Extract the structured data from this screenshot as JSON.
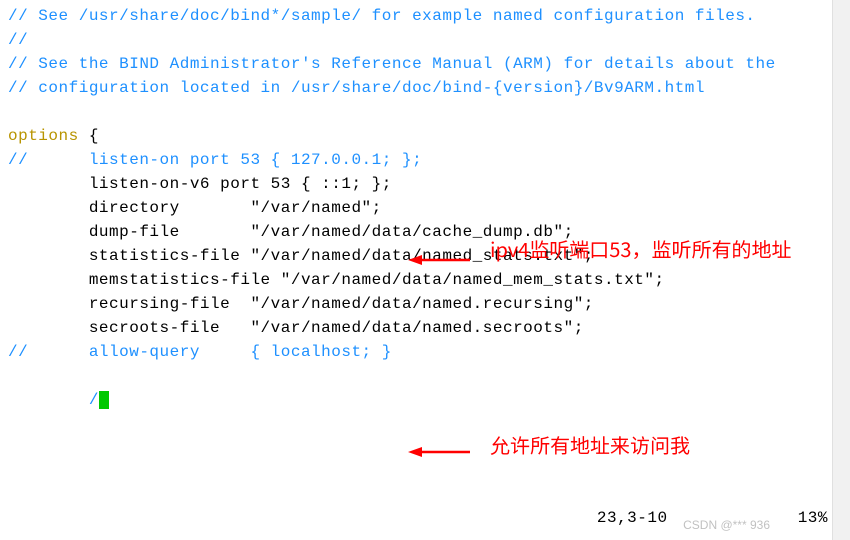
{
  "code": {
    "l1": "// See /usr/share/doc/bind*/sample/ for example named configuration files.",
    "l2": "//",
    "l3": "// See the BIND Administrator's Reference Manual (ARM) for details about the",
    "l4": "// configuration located in /usr/share/doc/bind-{version}/Bv9ARM.html",
    "l5": "",
    "l6a": "options",
    "l6b": " {",
    "l7a": "//",
    "l7b": "      listen-on port 53 { 127.0.0.1; };",
    "l8": "        listen-on-v6 port 53 { ::1; };",
    "l9": "        directory       \"/var/named\";",
    "l10": "        dump-file       \"/var/named/data/cache_dump.db\";",
    "l11": "        statistics-file \"/var/named/data/named_stats.txt\";",
    "l12": "        memstatistics-file \"/var/named/data/named_mem_stats.txt\";",
    "l13": "        recursing-file  \"/var/named/data/named.recursing\";",
    "l14": "        secroots-file   \"/var/named/data/named.secroots\";",
    "l15a": "//",
    "l15b": "      allow-query     { localhost; }",
    "l16": "",
    "l17_prefix": "        /",
    "l17_star": "*"
  },
  "annotations": {
    "annot1": "ipv4监听端口53，监听所有的地址",
    "annot2": "允许所有地址来访问我"
  },
  "status": {
    "pos": "23,3-10",
    "pct": "13%"
  },
  "watermark": "CSDN @*** 936"
}
